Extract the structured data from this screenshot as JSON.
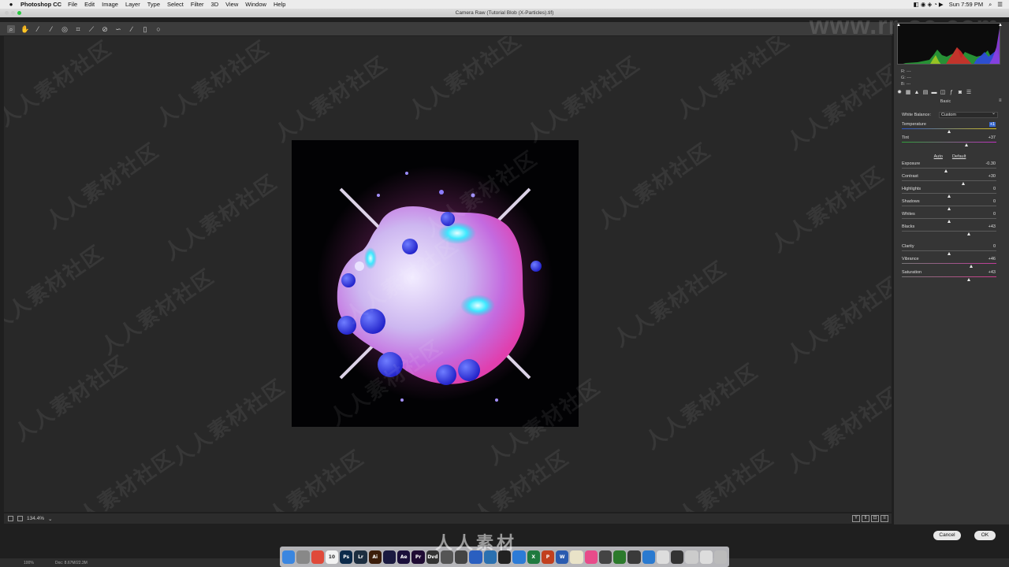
{
  "menubar": {
    "app_name": "Photoshop CC",
    "items": [
      "File",
      "Edit",
      "Image",
      "Layer",
      "Type",
      "Select",
      "Filter",
      "3D",
      "View",
      "Window",
      "Help"
    ],
    "clock": "Sun 7:59 PM"
  },
  "window": {
    "title": "Camera Raw (Tutorial Blob (X-Particles).tif)"
  },
  "toolbar": {
    "tools": [
      "zoom-icon",
      "hand-icon",
      "white-balance-icon",
      "color-sampler-icon",
      "targeted-adjust-icon",
      "crop-icon",
      "straighten-icon",
      "spot-removal-icon",
      "red-eye-icon",
      "adjustment-brush-icon",
      "graduated-filter-icon",
      "radial-filter-icon"
    ]
  },
  "watermark": {
    "url": "www.rr-sc.com",
    "text": "人人素材社区",
    "dock_text": "人人素材"
  },
  "zoom": {
    "level": "134.4%"
  },
  "histogram": {
    "r": "R:  ---",
    "g": "G:  ---",
    "b": "B:  ---"
  },
  "panel": {
    "heading": "Basic",
    "white_balance_label": "White Balance:",
    "white_balance_value": "Custom",
    "auto_label": "Auto",
    "default_label": "Default",
    "sliders": [
      {
        "label": "Temperature",
        "value": "+1",
        "level": 0.5,
        "track": "temp",
        "highlight": true
      },
      {
        "label": "Tint",
        "value": "+37",
        "level": 0.68,
        "track": "tint"
      },
      {
        "label": "Exposure",
        "value": "-0.30",
        "level": 0.47
      },
      {
        "label": "Contrast",
        "value": "+30",
        "level": 0.65
      },
      {
        "label": "Highlights",
        "value": "0",
        "level": 0.5
      },
      {
        "label": "Shadows",
        "value": "0",
        "level": 0.5
      },
      {
        "label": "Whites",
        "value": "0",
        "level": 0.5
      },
      {
        "label": "Blacks",
        "value": "+43",
        "level": 0.71
      },
      {
        "label": "Clarity",
        "value": "0",
        "level": 0.5
      },
      {
        "label": "Vibrance",
        "value": "+46",
        "level": 0.73,
        "track": "vib"
      },
      {
        "label": "Saturation",
        "value": "+43",
        "level": 0.71,
        "track": "sat"
      }
    ]
  },
  "buttons": {
    "cancel": "Cancel",
    "ok": "OK"
  },
  "status": {
    "zoom": "100%",
    "doc": "Doc: 8.67M/22.3M"
  },
  "dock": [
    {
      "name": "finder",
      "label": "",
      "color": "#3a86e0"
    },
    {
      "name": "launchpad",
      "label": "",
      "color": "#888"
    },
    {
      "name": "chrome",
      "label": "",
      "color": "#e04a3a"
    },
    {
      "name": "calendar",
      "label": "10",
      "color": "#f2f2f2"
    },
    {
      "name": "photoshop",
      "label": "Ps",
      "color": "#0b2a4a"
    },
    {
      "name": "lightroom",
      "label": "Lr",
      "color": "#1c2e40"
    },
    {
      "name": "illustrator",
      "label": "Ai",
      "color": "#3b1d0a"
    },
    {
      "name": "cinema4d",
      "label": "",
      "color": "#1a1a40"
    },
    {
      "name": "after-effects",
      "label": "Ae",
      "color": "#1a0f3a"
    },
    {
      "name": "premiere",
      "label": "Pr",
      "color": "#1f0b33"
    },
    {
      "name": "dvd",
      "label": "Dvd",
      "color": "#333"
    },
    {
      "name": "davinci",
      "label": "",
      "color": "#555"
    },
    {
      "name": "app-a",
      "label": "",
      "color": "#444"
    },
    {
      "name": "app-b",
      "label": "",
      "color": "#2a5fc0"
    },
    {
      "name": "app-c",
      "label": "",
      "color": "#2a70b0"
    },
    {
      "name": "app-d",
      "label": "",
      "color": "#222"
    },
    {
      "name": "app-e",
      "label": "",
      "color": "#2c7bd6"
    },
    {
      "name": "excel",
      "label": "X",
      "color": "#1f7a3f"
    },
    {
      "name": "powerpoint",
      "label": "P",
      "color": "#c2401f"
    },
    {
      "name": "word",
      "label": "W",
      "color": "#2a5bb0"
    },
    {
      "name": "notes",
      "label": "",
      "color": "#e9e3c8"
    },
    {
      "name": "itunes",
      "label": "",
      "color": "#e84b8a"
    },
    {
      "name": "app-f",
      "label": "",
      "color": "#444"
    },
    {
      "name": "app-g",
      "label": "",
      "color": "#2c7a2c"
    },
    {
      "name": "app-h",
      "label": "",
      "color": "#3a3a3a"
    },
    {
      "name": "safari",
      "label": "",
      "color": "#2a7ad0"
    },
    {
      "name": "app-i",
      "label": "",
      "color": "#ddd"
    },
    {
      "name": "app-j",
      "label": "",
      "color": "#333"
    },
    {
      "name": "app-k",
      "label": "",
      "color": "#ccc"
    },
    {
      "name": "app-l",
      "label": "",
      "color": "#ddd"
    },
    {
      "name": "trash",
      "label": "",
      "color": "#bbb"
    }
  ]
}
